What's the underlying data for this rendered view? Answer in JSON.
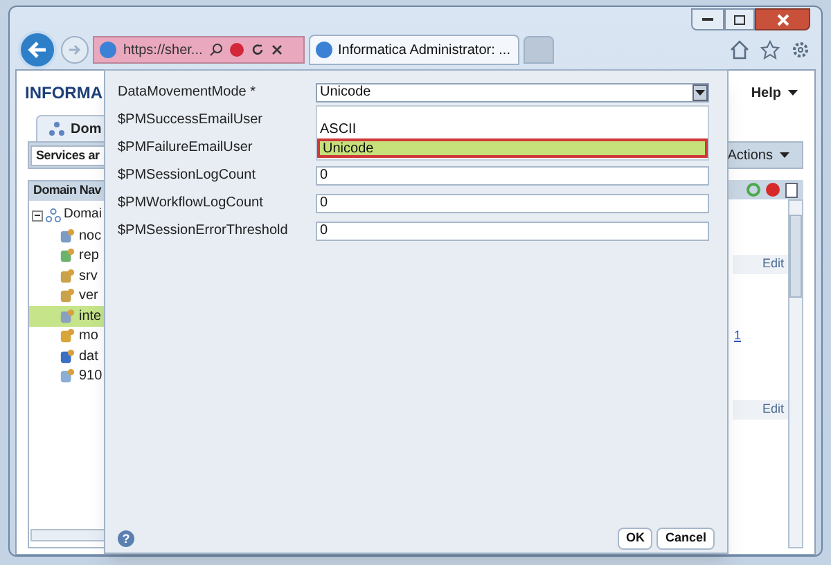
{
  "browser": {
    "address": "https://sher...",
    "tab_title": "Informatica Administrator: ..."
  },
  "app": {
    "logo": "INFORMA",
    "help_menu": "Help",
    "tab": "Dom",
    "toolbar_label": "Services ar",
    "actions_button": "Actions",
    "navigator": {
      "title": "Domain Nav",
      "tree": [
        {
          "label": "Domai",
          "expanded": true,
          "children": [
            {
              "label": "noc",
              "selected": false
            },
            {
              "label": "rep",
              "selected": false
            },
            {
              "label": "srv",
              "selected": false
            },
            {
              "label": "ver",
              "selected": false
            },
            {
              "label": "inte",
              "selected": true
            },
            {
              "label": "mo",
              "selected": false
            },
            {
              "label": "dat",
              "selected": false
            },
            {
              "label": "910",
              "selected": false
            }
          ]
        }
      ]
    },
    "details": {
      "edit_links": [
        "Edit",
        "Edit"
      ],
      "link": "1"
    }
  },
  "dialog": {
    "fields": [
      {
        "label": "DataMovementMode *",
        "kind": "select",
        "value": "Unicode",
        "open": true,
        "options": [
          {
            "label": "ASCII",
            "selected": false
          },
          {
            "label": "Unicode",
            "selected": true
          }
        ]
      },
      {
        "label": "$PMSuccessEmailUser"
      },
      {
        "label": "$PMFailureEmailUser"
      },
      {
        "label": "$PMSessionLogCount",
        "kind": "text",
        "value": "0"
      },
      {
        "label": "$PMWorkflowLogCount",
        "kind": "text",
        "value": "0"
      },
      {
        "label": "$PMSessionErrorThreshold",
        "kind": "text",
        "value": "0"
      }
    ],
    "help": "?",
    "buttons": [
      "OK",
      "Cancel"
    ]
  }
}
